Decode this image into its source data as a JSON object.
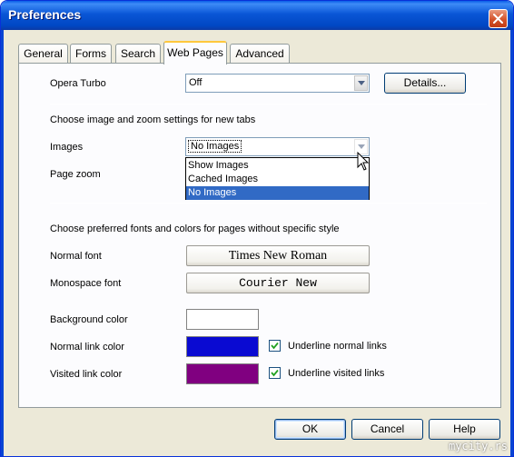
{
  "window": {
    "title": "Preferences"
  },
  "tabs": [
    {
      "label": "General"
    },
    {
      "label": "Forms"
    },
    {
      "label": "Search"
    },
    {
      "label": "Web Pages"
    },
    {
      "label": "Advanced"
    }
  ],
  "active_tab": "Web Pages",
  "turbo": {
    "label": "Opera Turbo",
    "value": "Off",
    "details_label": "Details..."
  },
  "images_section": {
    "heading": "Choose image and zoom settings for new tabs",
    "images_label": "Images",
    "images_value": "No Images",
    "zoom_label": "Page zoom",
    "options": [
      "Show Images",
      "Cached Images",
      "No Images"
    ],
    "selected_option": "No Images"
  },
  "fonts_section": {
    "heading": "Choose preferred fonts and colors for pages without specific style",
    "normal_font_label": "Normal font",
    "normal_font_value": "Times New Roman",
    "mono_font_label": "Monospace font",
    "mono_font_value": "Courier New"
  },
  "colors": {
    "background_label": "Background color",
    "background_color": "#ffffff",
    "normal_link_label": "Normal link color",
    "normal_link_color": "#0a0ad2",
    "visited_link_label": "Visited link color",
    "visited_link_color": "#800080",
    "underline_normal_label": "Underline normal links",
    "underline_normal_checked": true,
    "underline_visited_label": "Underline visited links",
    "underline_visited_checked": true
  },
  "footer": {
    "ok_label": "OK",
    "cancel_label": "Cancel",
    "help_label": "Help"
  },
  "watermark": "mycity.rs"
}
